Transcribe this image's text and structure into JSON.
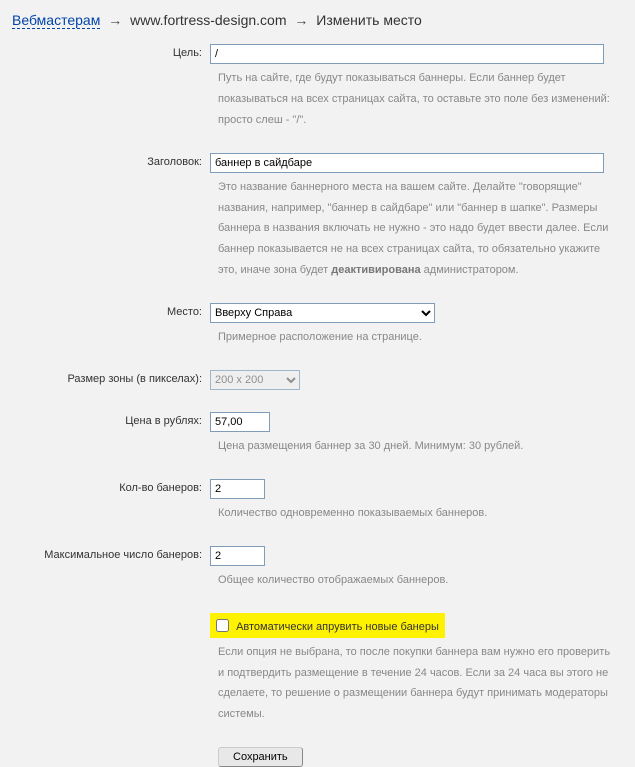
{
  "breadcrumb": {
    "link": "Вебмастерам",
    "domain": "www.fortress-design.com",
    "current": "Изменить место",
    "arrow": "→"
  },
  "fields": {
    "goal": {
      "label": "Цель:",
      "value": "/",
      "help": "Путь на сайте, где будут показываться баннеры. Если баннер будет показываться на всех страницах сайта, то оставьте это поле без изменений: просто слеш - \"/\"."
    },
    "title": {
      "label": "Заголовок:",
      "value": "баннер в сайдбаре",
      "help_before": "Это название баннерного места на вашем сайте. Делайте \"говорящие\" названия, например, \"баннер в сайдбаре\" или \"баннер в шапке\". Размеры баннера в названия включать не нужно - это надо будет ввести далее. Если баннер показывается не на всех страницах сайта, то обязательно укажите это, иначе зона будет ",
      "help_strong": "деактивирована",
      "help_after": " администратором."
    },
    "place": {
      "label": "Место:",
      "value": "Вверху Справа",
      "help": "Примерное расположение на странице."
    },
    "size": {
      "label": "Размер зоны (в пикселах):",
      "value": "200 x 200"
    },
    "price": {
      "label": "Цена в рублях:",
      "value": "57,00",
      "help": "Цена размещения баннер за 30 дней. Минимум: 30 рублей."
    },
    "count": {
      "label": "Кол-во банеров:",
      "value": "2",
      "help": "Количество одновременно показываемых баннеров."
    },
    "max": {
      "label": "Максимальное число банеров:",
      "value": "2",
      "help": "Общее количество отображаемых баннеров."
    },
    "auto": {
      "label": "Автоматически апрувить новые банеры",
      "help": "Если опция не выбрана, то после покупки баннера вам нужно его проверить и подтвердить размещение в течение 24 часов. Если за 24 часа вы этого не сделаете, то решение о размещении баннера будут принимать модераторы системы."
    }
  },
  "submit": "Сохранить"
}
